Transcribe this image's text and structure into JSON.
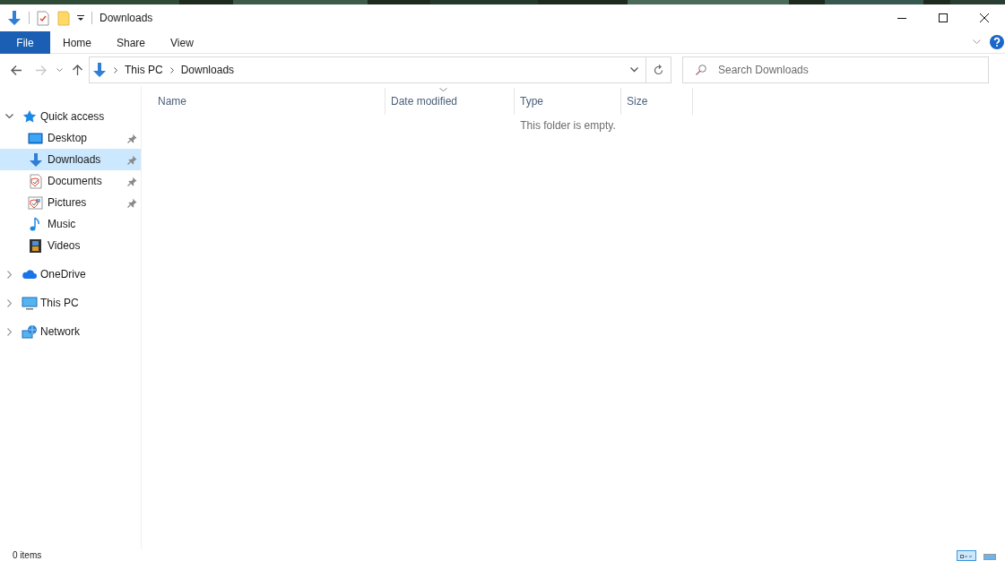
{
  "window": {
    "title": "Downloads"
  },
  "ribbon": {
    "tabs": [
      {
        "label": "File",
        "kind": "file",
        "selected": false
      },
      {
        "label": "Home",
        "kind": "tab",
        "selected": false
      },
      {
        "label": "Share",
        "kind": "tab",
        "selected": false
      },
      {
        "label": "View",
        "kind": "tab",
        "selected": false
      }
    ]
  },
  "address_bar": {
    "path": [
      "This PC",
      "Downloads"
    ]
  },
  "search": {
    "placeholder": "Search Downloads"
  },
  "navigation": [
    {
      "label": "Quick access",
      "kind": "star",
      "expanded": true,
      "selected": false,
      "children": [
        {
          "label": "Desktop",
          "kind": "desktop",
          "pinned": true,
          "selected": false
        },
        {
          "label": "Downloads",
          "kind": "download",
          "pinned": true,
          "selected": true
        },
        {
          "label": "Documents",
          "kind": "document",
          "pinned": true,
          "selected": false
        },
        {
          "label": "Pictures",
          "kind": "pictures",
          "pinned": true,
          "selected": false
        },
        {
          "label": "Music",
          "kind": "music",
          "pinned": false,
          "selected": false
        },
        {
          "label": "Videos",
          "kind": "videos",
          "pinned": false,
          "selected": false
        }
      ]
    },
    {
      "label": "OneDrive",
      "kind": "cloud",
      "expanded": false,
      "selected": false
    },
    {
      "label": "This PC",
      "kind": "computer",
      "expanded": false,
      "selected": false
    },
    {
      "label": "Network",
      "kind": "network",
      "expanded": false,
      "selected": false
    }
  ],
  "columns": [
    {
      "label": "Name",
      "sorted": false
    },
    {
      "label": "Date modified",
      "sorted": true
    },
    {
      "label": "Type",
      "sorted": false
    },
    {
      "label": "Size",
      "sorted": false
    }
  ],
  "empty_message": "This folder is empty.",
  "status_bar": {
    "item_count": "0 items",
    "views": [
      {
        "kind": "details",
        "selected": true
      },
      {
        "kind": "large_icons",
        "selected": false
      }
    ]
  }
}
